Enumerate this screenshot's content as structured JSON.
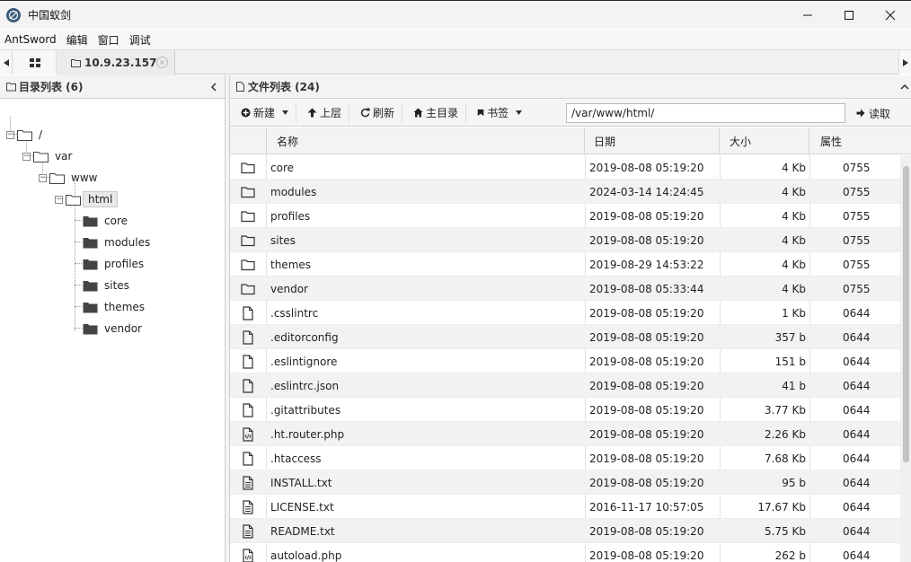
{
  "window": {
    "title": "中国蚁剑"
  },
  "menu": [
    "AntSword",
    "编辑",
    "窗口",
    "调试"
  ],
  "tabs": {
    "active_label": "10.9.23.157",
    "close_glyph": "×"
  },
  "left_panel": {
    "title": "目录列表 (6)",
    "tree": {
      "root": "/",
      "var": "var",
      "www": "www",
      "html": "html",
      "children": [
        "core",
        "modules",
        "profiles",
        "sites",
        "themes",
        "vendor"
      ]
    }
  },
  "right_panel": {
    "title": "文件列表 (24)",
    "toolbar": {
      "new": "新建",
      "up": "上层",
      "refresh": "刷新",
      "home": "主目录",
      "bookmark": "书签",
      "path": "/var/www/html/",
      "read": "读取"
    },
    "columns": {
      "name": "名称",
      "date": "日期",
      "size": "大小",
      "attr": "属性"
    },
    "files": [
      {
        "icon": "folder-icon",
        "name": "core",
        "date": "2019-08-08 05:19:20",
        "size": "4 Kb",
        "attr": "0755"
      },
      {
        "icon": "folder-icon",
        "name": "modules",
        "date": "2024-03-14 14:24:45",
        "size": "4 Kb",
        "attr": "0755"
      },
      {
        "icon": "folder-icon",
        "name": "profiles",
        "date": "2019-08-08 05:19:20",
        "size": "4 Kb",
        "attr": "0755"
      },
      {
        "icon": "folder-icon",
        "name": "sites",
        "date": "2019-08-08 05:19:20",
        "size": "4 Kb",
        "attr": "0755"
      },
      {
        "icon": "folder-icon",
        "name": "themes",
        "date": "2019-08-29 14:53:22",
        "size": "4 Kb",
        "attr": "0755"
      },
      {
        "icon": "folder-icon",
        "name": "vendor",
        "date": "2019-08-08 05:33:44",
        "size": "4 Kb",
        "attr": "0755"
      },
      {
        "icon": "file-icon",
        "name": ".csslintrc",
        "date": "2019-08-08 05:19:20",
        "size": "1 Kb",
        "attr": "0644"
      },
      {
        "icon": "file-icon",
        "name": ".editorconfig",
        "date": "2019-08-08 05:19:20",
        "size": "357 b",
        "attr": "0644"
      },
      {
        "icon": "file-icon",
        "name": ".eslintignore",
        "date": "2019-08-08 05:19:20",
        "size": "151 b",
        "attr": "0644"
      },
      {
        "icon": "file-icon",
        "name": ".eslintrc.json",
        "date": "2019-08-08 05:19:20",
        "size": "41 b",
        "attr": "0644"
      },
      {
        "icon": "file-icon",
        "name": ".gitattributes",
        "date": "2019-08-08 05:19:20",
        "size": "3.77 Kb",
        "attr": "0644"
      },
      {
        "icon": "code-file-icon",
        "name": ".ht.router.php",
        "date": "2019-08-08 05:19:20",
        "size": "2.26 Kb",
        "attr": "0644"
      },
      {
        "icon": "file-icon",
        "name": ".htaccess",
        "date": "2019-08-08 05:19:20",
        "size": "7.68 Kb",
        "attr": "0644"
      },
      {
        "icon": "text-file-icon",
        "name": "INSTALL.txt",
        "date": "2019-08-08 05:19:20",
        "size": "95 b",
        "attr": "0644"
      },
      {
        "icon": "text-file-icon",
        "name": "LICENSE.txt",
        "date": "2016-11-17 10:57:05",
        "size": "17.67 Kb",
        "attr": "0644"
      },
      {
        "icon": "text-file-icon",
        "name": "README.txt",
        "date": "2019-08-08 05:19:20",
        "size": "5.75 Kb",
        "attr": "0644"
      },
      {
        "icon": "code-file-icon",
        "name": "autoload.php",
        "date": "2019-08-08 05:19:20",
        "size": "262 b",
        "attr": "0644"
      }
    ]
  }
}
